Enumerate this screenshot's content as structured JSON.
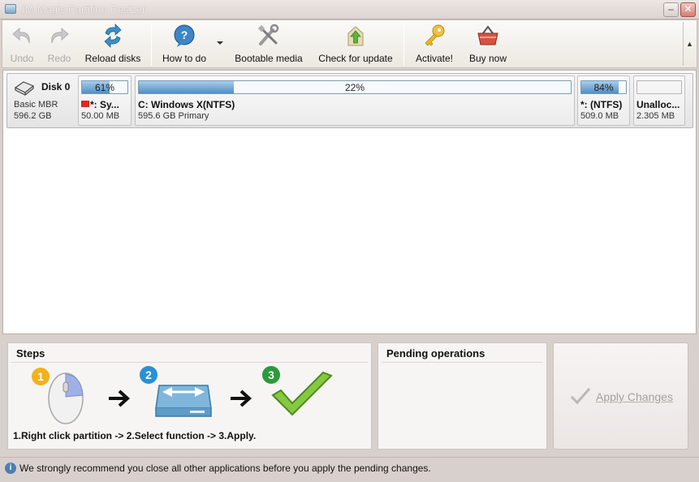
{
  "window": {
    "title": "IM-Magic Partition Resizer"
  },
  "toolbar": {
    "undo": "Undo",
    "redo": "Redo",
    "reload": "Reload disks",
    "howto": "How to do",
    "bootable": "Bootable media",
    "update": "Check for update",
    "activate": "Activate!",
    "buy": "Buy now"
  },
  "disk": {
    "name": "Disk 0",
    "type": "Basic MBR",
    "size": "596.2 GB",
    "partitions": [
      {
        "percent": "61%",
        "used_fraction": 0.61,
        "label": "*: Sy...",
        "sub": "50.00 MB",
        "system_flag": true
      },
      {
        "percent": "22%",
        "used_fraction": 0.22,
        "label": "C: Windows X(NTFS)",
        "sub": "595.6 GB Primary"
      },
      {
        "percent": "84%",
        "used_fraction": 0.84,
        "label": "*: (NTFS)",
        "sub": "509.0 MB"
      },
      {
        "percent": "",
        "used_fraction": 0,
        "label": "Unalloc...",
        "sub": "2.305 MB"
      }
    ]
  },
  "steps": {
    "title": "Steps",
    "num1": "1",
    "num2": "2",
    "num3": "3",
    "text": "1.Right click partition -> 2.Select function -> 3.Apply."
  },
  "pending": {
    "title": "Pending operations"
  },
  "apply": {
    "label": "Apply Changes"
  },
  "status": {
    "text": "We strongly recommend you close all other applications before you apply the pending changes."
  },
  "colors": {
    "bar_fill": "#4e8fc6",
    "step1": "#f2b21d",
    "step2": "#2a8fd6",
    "step3": "#2a9a3a",
    "check_green": "#7cc23a"
  }
}
